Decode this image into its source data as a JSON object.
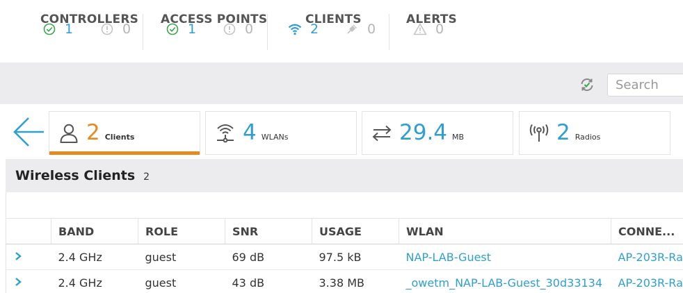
{
  "status": {
    "controllers": {
      "title": "CONTROLLERS",
      "ok": "1",
      "warn": "0"
    },
    "access_points": {
      "title": "ACCESS POINTS",
      "ok": "1",
      "warn": "0"
    },
    "clients": {
      "title": "CLIENTS",
      "wireless": "2",
      "wired": "0"
    },
    "alerts": {
      "title": "ALERTS",
      "count": "0"
    }
  },
  "toolbar": {
    "search_placeholder": "Search"
  },
  "cards": [
    {
      "value": "2",
      "unit": "Clients",
      "icon": "user-icon",
      "active": true
    },
    {
      "value": "4",
      "unit": "WLANs",
      "icon": "wlan-icon",
      "active": false
    },
    {
      "value": "29.4",
      "unit": "MB",
      "icon": "transfer-icon",
      "active": false
    },
    {
      "value": "2",
      "unit": "Radios",
      "icon": "radio-antenna-icon",
      "active": false
    }
  ],
  "panel": {
    "title": "Wireless Clients",
    "count": "2"
  },
  "table": {
    "headers": [
      "",
      "BAND",
      "ROLE",
      "SNR",
      "USAGE",
      "WLAN",
      "CONNE..."
    ],
    "rows": [
      {
        "band": "2.4 GHz",
        "role": "guest",
        "snr": "69 dB",
        "usage": "97.5 kB",
        "wlan": "NAP-LAB-Guest",
        "connected": "AP-203R-Ra"
      },
      {
        "band": "2.4 GHz",
        "role": "guest",
        "snr": "43 dB",
        "usage": "3.38 MB",
        "wlan": "_owetm_NAP-LAB-Guest_30d33134",
        "connected": "AP-203R-Ra"
      }
    ]
  },
  "colors": {
    "accent": "#2e9fd0",
    "ok": "#3aa64a",
    "active": "#e68a1f",
    "muted": "#b5b5b5"
  }
}
